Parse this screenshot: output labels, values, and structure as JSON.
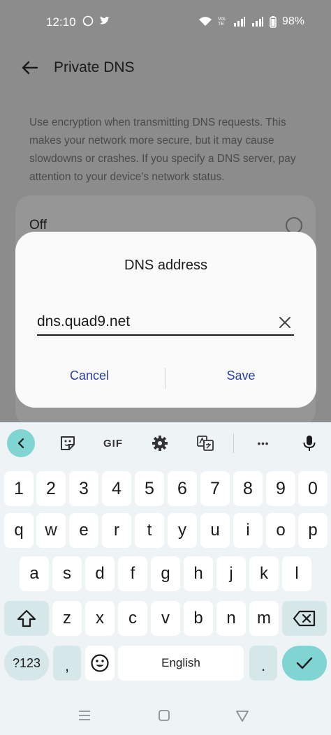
{
  "status_bar": {
    "time": "12:10",
    "notification_icons": [
      "whatsapp-icon",
      "twitter-icon"
    ],
    "network_label": "VoLTE",
    "battery": "98%"
  },
  "app_bar": {
    "title": "Private DNS"
  },
  "description": "Use encryption when transmitting DNS requests. This makes your network more secure, but it may cause slowdowns or crashes. If you specify a DNS server, pay attention to your device's network status.",
  "options": {
    "off_label": "Off"
  },
  "dialog": {
    "title": "DNS address",
    "input_value": "dns.quad9.net",
    "cancel_label": "Cancel",
    "save_label": "Save"
  },
  "keyboard": {
    "toolbar": {
      "gif_label": "GIF",
      "more_label": "•••"
    },
    "row_numbers": [
      "1",
      "2",
      "3",
      "4",
      "5",
      "6",
      "7",
      "8",
      "9",
      "0"
    ],
    "row_top": [
      "q",
      "w",
      "e",
      "r",
      "t",
      "y",
      "u",
      "i",
      "o",
      "p"
    ],
    "row_home": [
      "a",
      "s",
      "d",
      "f",
      "g",
      "h",
      "j",
      "k",
      "l"
    ],
    "row_bottom": [
      "z",
      "x",
      "c",
      "v",
      "b",
      "n",
      "m"
    ],
    "symbols_label": "?123",
    "comma_label": ",",
    "space_label": "English",
    "period_label": "."
  },
  "colors": {
    "accent": "#2a3ea5",
    "keyboard_accent": "#80d4d2",
    "scrim": "#8c8c8c"
  }
}
